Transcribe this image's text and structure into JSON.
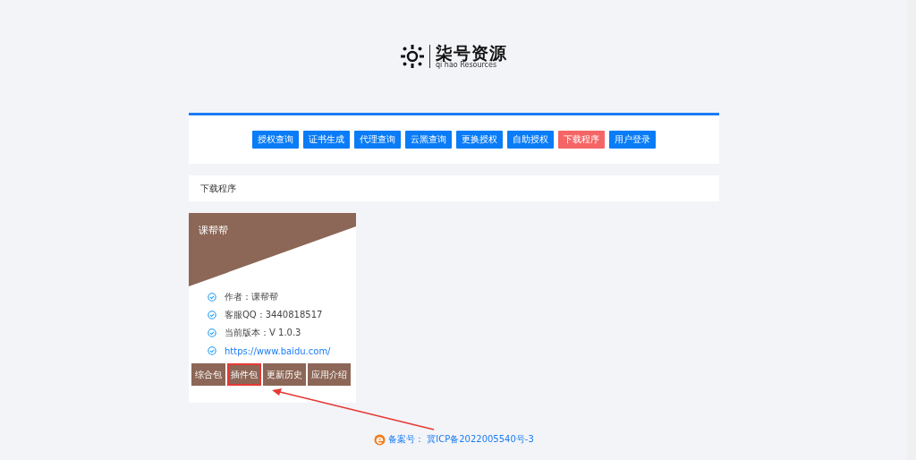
{
  "logo": {
    "name": "柒号资源",
    "subtitle": "qi hao Resources"
  },
  "nav": [
    {
      "label": "授权查询",
      "selected": false
    },
    {
      "label": "证书生成",
      "selected": false
    },
    {
      "label": "代理查询",
      "selected": false
    },
    {
      "label": "云黑查询",
      "selected": false
    },
    {
      "label": "更换授权",
      "selected": false
    },
    {
      "label": "自助授权",
      "selected": false
    },
    {
      "label": "下载程序",
      "selected": true
    },
    {
      "label": "用户登录",
      "selected": false
    }
  ],
  "section_title": "下载程序",
  "app": {
    "name": "课帮帮",
    "info": [
      {
        "kind": "text",
        "text": "作者：课帮帮"
      },
      {
        "kind": "text",
        "text": "客服QQ：3440818517"
      },
      {
        "kind": "text",
        "text": "当前版本：V 1.0.3"
      },
      {
        "kind": "link",
        "text": "https://www.baidu.com/"
      }
    ],
    "buttons": [
      {
        "label": "综合包",
        "highlighted": false
      },
      {
        "label": "插件包",
        "highlighted": true
      },
      {
        "label": "更新历史",
        "highlighted": false
      },
      {
        "label": "应用介绍",
        "highlighted": false
      }
    ]
  },
  "footer": {
    "label": "备案号：",
    "record": "冀ICP备2022005540号-3"
  }
}
